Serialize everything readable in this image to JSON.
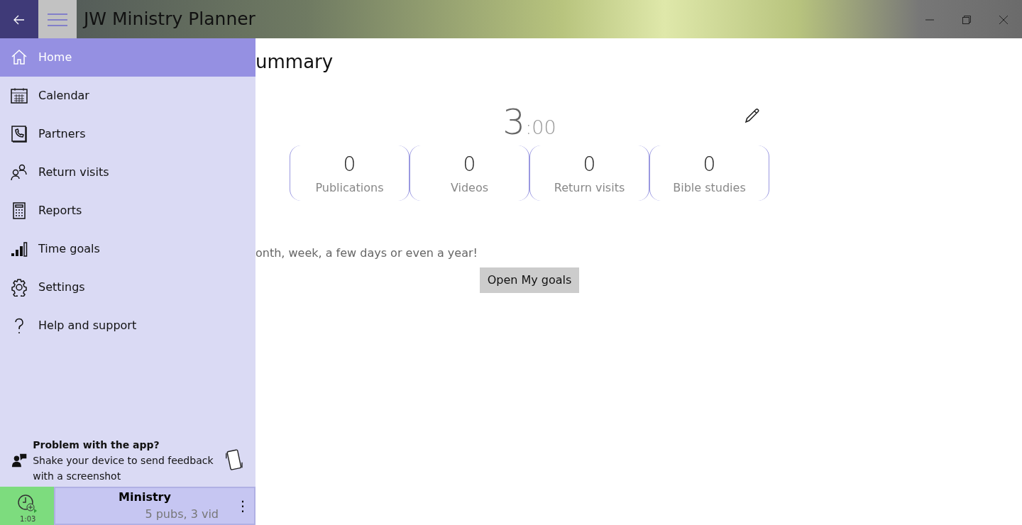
{
  "window": {
    "title": "JW Ministry Planner"
  },
  "nav": {
    "items": [
      {
        "label": "Home",
        "selected": true
      },
      {
        "label": "Calendar",
        "selected": false
      },
      {
        "label": "Partners",
        "selected": false
      },
      {
        "label": "Return visits",
        "selected": false
      },
      {
        "label": "Reports",
        "selected": false
      },
      {
        "label": "Time goals",
        "selected": false
      },
      {
        "label": "Settings",
        "selected": false
      },
      {
        "label": "Help and support",
        "selected": false
      }
    ],
    "feedback": {
      "title": "Problem with the app?",
      "text": "Shake your device to send feedback with a screenshot"
    },
    "timer": {
      "time": "1:03"
    },
    "ministry": {
      "title": "Ministry",
      "subtitle": "5 pubs, 3 vid",
      "menu": "⋮"
    }
  },
  "summary": {
    "heading": "ummary",
    "hours": "3",
    "minutes": ":00",
    "stats": [
      {
        "value": "0",
        "label": "Publications"
      },
      {
        "value": "0",
        "label": "Videos"
      },
      {
        "value": "0",
        "label": "Return visits"
      },
      {
        "value": "0",
        "label": "Bible studies"
      }
    ],
    "goal_text": "onth, week, a few days or even a year!",
    "goal_button": "Open My goals"
  }
}
